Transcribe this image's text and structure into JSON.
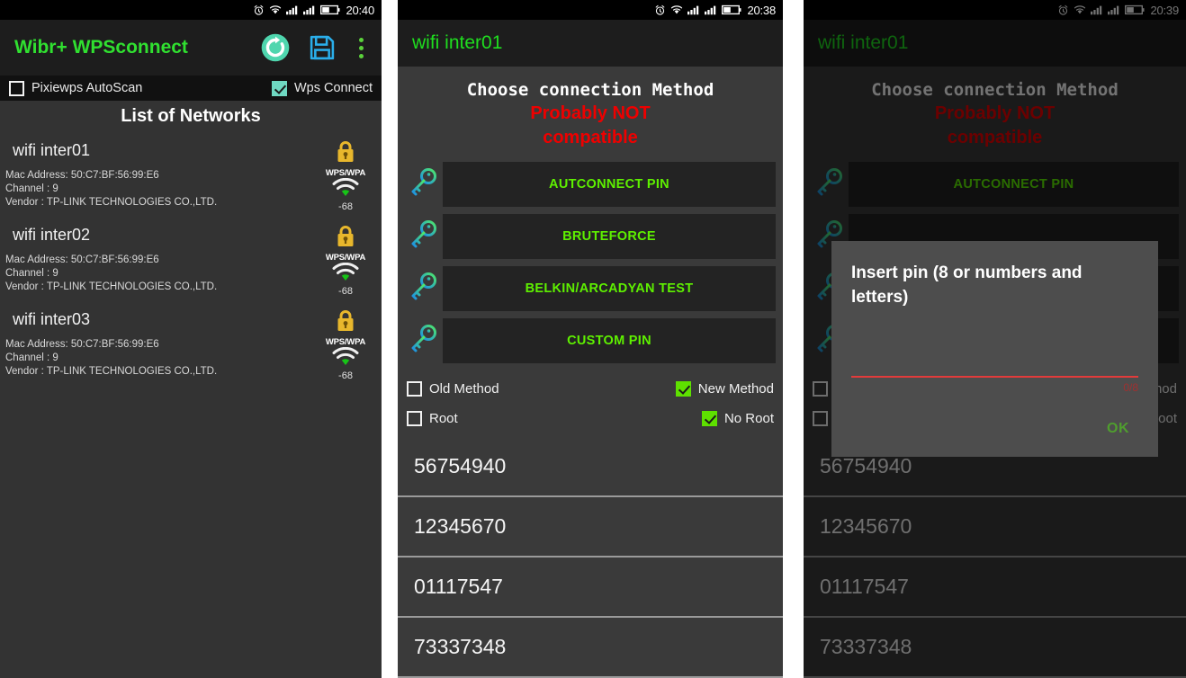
{
  "panel1": {
    "status_bar": {
      "time": "20:40",
      "icons": [
        "alarm-icon",
        "wifi-icon",
        "signal-icon-1",
        "signal-icon-2",
        "battery-icon"
      ]
    },
    "appbar": {
      "title": "Wibr+ WPSconnect",
      "refresh_icon": "refresh-icon",
      "save_icon": "save-icon",
      "overflow_icon": "overflow-menu-icon"
    },
    "options": {
      "pixiewps_label": "Pixiewps AutoScan",
      "pixiewps_checked": false,
      "wps_connect_label": "Wps Connect",
      "wps_connect_checked": true
    },
    "list_heading": "List of Networks",
    "networks": [
      {
        "ssid": "wifi inter01",
        "mac": "Mac Address: 50:C7:BF:56:99:E6",
        "channel": "Channel : 9",
        "vendor": "Vendor : TP-LINK TECHNOLOGIES CO.,LTD.",
        "security": "WPS/WPA",
        "rssi": "-68"
      },
      {
        "ssid": "wifi inter02",
        "mac": "Mac Address: 50:C7:BF:56:99:E6",
        "channel": "Channel : 9",
        "vendor": "Vendor : TP-LINK TECHNOLOGIES CO.,LTD.",
        "security": "WPS/WPA",
        "rssi": "-68"
      },
      {
        "ssid": "wifi inter03",
        "mac": "Mac Address: 50:C7:BF:56:99:E6",
        "channel": "Channel : 9",
        "vendor": "Vendor : TP-LINK TECHNOLOGIES CO.,LTD.",
        "security": "WPS/WPA",
        "rssi": "-68"
      }
    ]
  },
  "panel2": {
    "status_bar": {
      "time": "20:38"
    },
    "ssid": "wifi inter01",
    "choose_title": "Choose connection Method",
    "warning_line1": "Probably NOT",
    "warning_line2": "compatible",
    "methods": [
      {
        "label": "AUTCONNECT PIN",
        "icon": "key-icon"
      },
      {
        "label": "BRUTEFORCE",
        "icon": "key-icon"
      },
      {
        "label": "BELKIN/ARCADYAN TEST",
        "icon": "key-icon"
      },
      {
        "label": "CUSTOM PIN",
        "icon": "key-icon"
      }
    ],
    "options": {
      "old_method_label": "Old Method",
      "old_method_checked": false,
      "new_method_label": "New Method",
      "new_method_checked": true,
      "root_label": "Root",
      "root_checked": false,
      "no_root_label": "No Root",
      "no_root_checked": true
    },
    "pins": [
      "56754940",
      "12345670",
      "01117547",
      "73337348"
    ]
  },
  "panel3": {
    "status_bar": {
      "time": "20:39"
    },
    "ssid": "wifi inter01",
    "choose_title": "Choose connection Method",
    "warning_line1": "Probably NOT",
    "warning_line2": "compatible",
    "methods": [
      {
        "label": "AUTCONNECT PIN",
        "icon": "key-icon"
      },
      {
        "label": "",
        "icon": "key-icon"
      },
      {
        "label": "",
        "icon": "key-icon"
      },
      {
        "label": "",
        "icon": "key-icon"
      }
    ],
    "options": {
      "new_method_label": "thod",
      "no_root_label": "Root"
    },
    "pins": [
      "56754940",
      "12345670",
      "01117547",
      "73337348"
    ],
    "dialog": {
      "title": "Insert pin (8 or  numbers and letters)",
      "input_value": "",
      "counter": "0/8",
      "ok_label": "OK"
    }
  },
  "colors": {
    "accent_green": "#30e030",
    "button_green": "#5ef000",
    "warning_red": "#ee0000",
    "lock_yellow": "#e8b72c",
    "teal_check": "#6fd9c2",
    "green_check": "#5ee000"
  }
}
